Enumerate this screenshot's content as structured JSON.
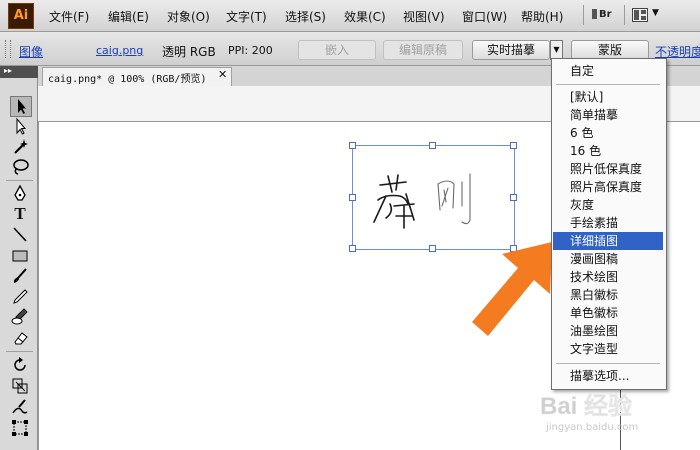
{
  "app": {
    "logo": "Ai"
  },
  "menubar": {
    "items": [
      "文件(F)",
      "编辑(E)",
      "对象(O)",
      "文字(T)",
      "选择(S)",
      "效果(C)",
      "视图(V)",
      "窗口(W)",
      "帮助(H)"
    ],
    "bridge_label": "Br",
    "icons": [
      "bridge-icon",
      "arrange-documents-icon"
    ]
  },
  "controlbar": {
    "object_type": "图像",
    "file_name": "caig.png",
    "transparency": "透明 RGB",
    "ppi": "PPI: 200",
    "embed_label": "嵌入",
    "edit_original_label": "编辑原稿",
    "live_trace_label": "实时描摹",
    "mask_label": "蒙版",
    "opacity_label": "不透明度"
  },
  "toolbox": {
    "tools": [
      "selection-tool",
      "direct-selection-tool",
      "magic-wand-tool",
      "lasso-tool",
      "pen-tool",
      "type-tool",
      "line-tool",
      "rectangle-tool",
      "paintbrush-tool",
      "pencil-tool",
      "blob-brush-tool",
      "eraser-tool",
      "rotate-tool",
      "scale-tool",
      "warp-tool",
      "free-transform-tool"
    ],
    "type_glyph": "T"
  },
  "document": {
    "tab_title": "caig.png* @ 100% (RGB/预览)",
    "close_glyph": "✕"
  },
  "trace_menu": {
    "items": [
      "自定",
      "[默认]",
      "简单描摹",
      "6 色",
      "16 色",
      "照片低保真度",
      "照片高保真度",
      "灰度",
      "手绘素描",
      "详细插图",
      "漫画图稿",
      "技术绘图",
      "黑白徽标",
      "单色徽标",
      "油墨绘图",
      "文字造型",
      "描摹选项..."
    ],
    "highlighted": "详细插图"
  },
  "watermark": {
    "brand": "Bai 经验",
    "url": "jingyan.baidu.com"
  },
  "colors": {
    "accent": "#3163c6",
    "arrow": "#f47b20",
    "logo_bg": "#3b1a02",
    "logo_fg": "#ff9a1e"
  }
}
